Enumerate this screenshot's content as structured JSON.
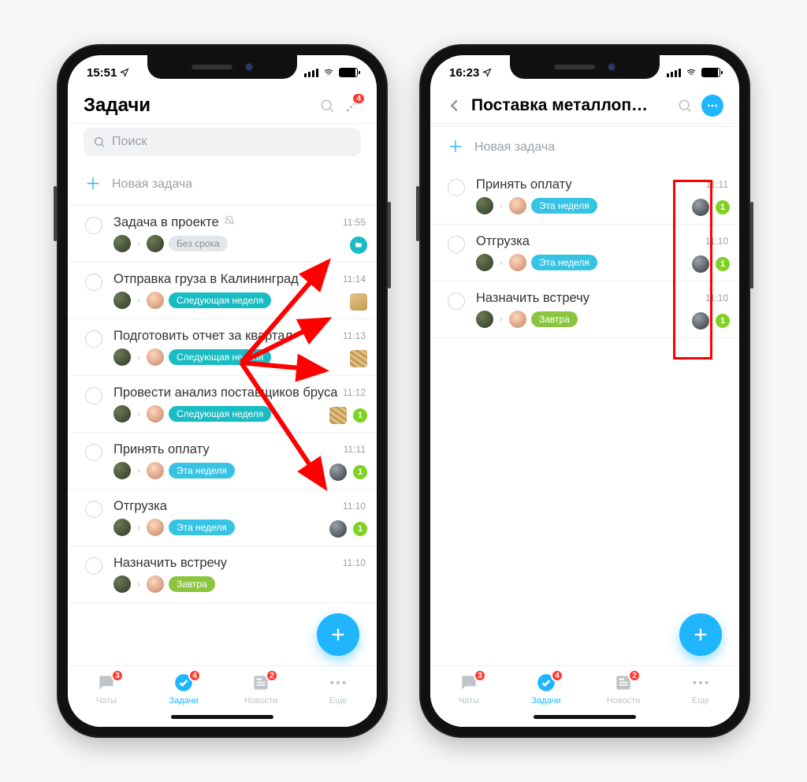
{
  "left": {
    "status_time": "15:51",
    "header_title": "Задачи",
    "notif_badge": "4",
    "search_placeholder": "Поиск",
    "new_task": "Новая задача",
    "tasks": [
      {
        "title": "Задача в проекте",
        "muted": true,
        "time": "11:55",
        "deadline": "Без срока",
        "deadline_style": "gray",
        "trail_type": "teal-folder",
        "unread": null,
        "avatars": [
          "a1",
          "a1"
        ]
      },
      {
        "title": "Отправка груза в Калининград",
        "time": "11:14",
        "deadline": "Следующая неделя",
        "deadline_style": "teal",
        "trail_type": "box",
        "unread": null,
        "avatars": [
          "a1",
          "a2"
        ]
      },
      {
        "title": "Подготовить отчет за квартал",
        "time": "11:13",
        "deadline": "Следующая неделя",
        "deadline_style": "teal",
        "trail_type": "wood",
        "unread": null,
        "avatars": [
          "a1",
          "a2"
        ]
      },
      {
        "title": "Провести анализ поставщиков бруса",
        "time": "11:12",
        "deadline": "Следующая неделя",
        "deadline_style": "teal",
        "trail_type": "wood",
        "unread": "1",
        "avatars": [
          "a1",
          "a2"
        ]
      },
      {
        "title": "Принять оплату",
        "time": "11:11",
        "deadline": "Эта неделя",
        "deadline_style": "blue",
        "trail_type": "metal",
        "unread": "1",
        "avatars": [
          "a1",
          "a2"
        ]
      },
      {
        "title": "Отгрузка",
        "time": "11:10",
        "deadline": "Эта неделя",
        "deadline_style": "blue",
        "trail_type": "metal",
        "unread": "1",
        "avatars": [
          "a1",
          "a2"
        ]
      },
      {
        "title": "Назначить встречу",
        "time": "11:10",
        "deadline": "Завтра",
        "deadline_style": "green",
        "trail_type": "none",
        "unread": null,
        "avatars": [
          "a1",
          "a2"
        ]
      }
    ]
  },
  "right": {
    "status_time": "16:23",
    "header_title": "Поставка металлоп…",
    "new_task": "Новая задача",
    "tasks": [
      {
        "title": "Принять оплату",
        "time": "11:11",
        "deadline": "Эта неделя",
        "deadline_style": "blue",
        "trail_type": "metal",
        "unread": "1",
        "avatars": [
          "a1",
          "a2"
        ]
      },
      {
        "title": "Отгрузка",
        "time": "11:10",
        "deadline": "Эта неделя",
        "deadline_style": "blue",
        "trail_type": "metal",
        "unread": "1",
        "avatars": [
          "a1",
          "a2"
        ]
      },
      {
        "title": "Назначить встречу",
        "time": "11:10",
        "deadline": "Завтра",
        "deadline_style": "green",
        "trail_type": "metal",
        "unread": "1",
        "avatars": [
          "a1",
          "a2"
        ]
      }
    ]
  },
  "tabs": [
    {
      "id": "chats",
      "label": "Чаты",
      "badge": "3"
    },
    {
      "id": "tasks",
      "label": "Задачи",
      "badge": "4"
    },
    {
      "id": "news",
      "label": "Новости",
      "badge": "2"
    },
    {
      "id": "more",
      "label": "Еще",
      "badge": null
    }
  ]
}
